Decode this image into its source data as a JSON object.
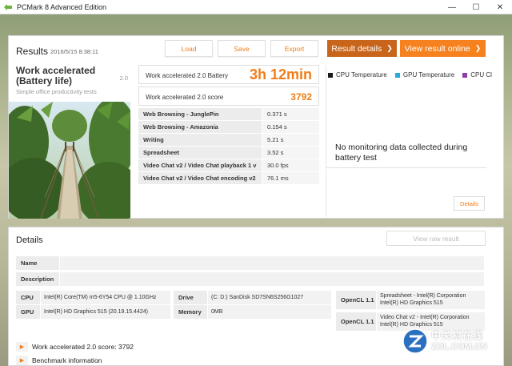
{
  "window": {
    "title": "PCMark 8 Advanced Edition",
    "minimize": "—",
    "maximize": "☐",
    "close": "✕"
  },
  "results": {
    "title": "Results",
    "date": "2016/5/15 8:38:11",
    "load_label": "Load",
    "save_label": "Save",
    "export_label": "Export",
    "details_label": "Result details",
    "online_label": "View result online",
    "chevron": "❯"
  },
  "test": {
    "name": "Work accelerated (Battery life)",
    "version": "2.0",
    "description": "Simple office productivity tests"
  },
  "scores": {
    "battery_label": "Work accelerated 2.0 Battery",
    "battery_value": "3h 12min",
    "score_label": "Work accelerated 2.0 score",
    "score_value": "3792"
  },
  "metrics": [
    {
      "name": "Web Browsing - JunglePin",
      "value": "0.371 s"
    },
    {
      "name": "Web Browsing - Amazonia",
      "value": "0.154 s"
    },
    {
      "name": "Writing",
      "value": "5.21 s"
    },
    {
      "name": "Spreadsheet",
      "value": "3.52 s"
    },
    {
      "name": "Video Chat v2 / Video Chat playback 1 v",
      "value": "30.0 fps"
    },
    {
      "name": "Video Chat v2 / Video Chat encoding v2",
      "value": "76.1 ms"
    }
  ],
  "monitoring": {
    "legend": [
      {
        "label": "CPU Temperature",
        "color": "#1a1a1a"
      },
      {
        "label": "GPU Temperature",
        "color": "#29a8e0"
      },
      {
        "label": "CPU Cl",
        "color": "#8b3fa8"
      }
    ],
    "message": "No monitoring data collected during battery test",
    "details_label": "Details"
  },
  "details": {
    "title": "Details",
    "view_raw_label": "View raw result",
    "name_label": "Name",
    "description_label": "Description",
    "cpu_label": "CPU",
    "cpu_value": "Intel(R) Core(TM) m5-6Y54 CPU @ 1.10GHz",
    "gpu_label": "GPU",
    "gpu_value": "Intel(R) HD Graphics 515 (20.19.15.4424)",
    "drive_label": "Drive",
    "drive_value": "(C: D:) SanDisk SD7SN6S256G1027",
    "memory_label": "Memory",
    "memory_value": "0MB",
    "opencl": [
      {
        "label": "OpenCL 1.1",
        "line1": "Spreadsheet - Intel(R) Corporation",
        "line2": "Intel(R) HD Graphics 515"
      },
      {
        "label": "OpenCL 1.1",
        "line1": "Video Chat v2 - Intel(R) Corporation",
        "line2": "Intel(R) HD Graphics 515"
      }
    ],
    "expanders": [
      {
        "label": "Work accelerated 2.0 score: 3792"
      },
      {
        "label": "Benchmark information"
      }
    ]
  },
  "watermark": {
    "chinese": "中关村在线",
    "domain": "ZOL.COM.CN"
  }
}
